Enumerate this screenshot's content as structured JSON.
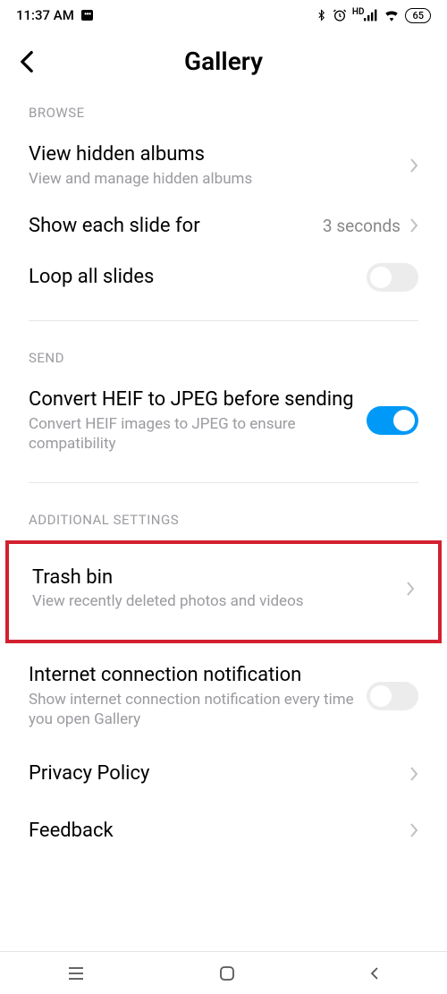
{
  "status": {
    "time": "11:37 AM",
    "battery": "65"
  },
  "header": {
    "title": "Gallery"
  },
  "sections": {
    "browse": {
      "label": "BROWSE",
      "hidden_albums": {
        "title": "View hidden albums",
        "sub": "View and manage hidden albums"
      },
      "slide_duration": {
        "title": "Show each slide for",
        "value": "3 seconds"
      },
      "loop": {
        "title": "Loop all slides"
      }
    },
    "send": {
      "label": "SEND",
      "heif": {
        "title": "Convert HEIF to JPEG before sending",
        "sub": "Convert HEIF images to JPEG to ensure compatibility"
      }
    },
    "additional": {
      "label": "ADDITIONAL SETTINGS",
      "trash": {
        "title": "Trash bin",
        "sub": "View recently deleted photos and videos"
      },
      "internet": {
        "title": "Internet connection notification",
        "sub": "Show internet connection notification every time you open Gallery"
      },
      "privacy": {
        "title": "Privacy Policy"
      },
      "feedback": {
        "title": "Feedback"
      }
    }
  }
}
